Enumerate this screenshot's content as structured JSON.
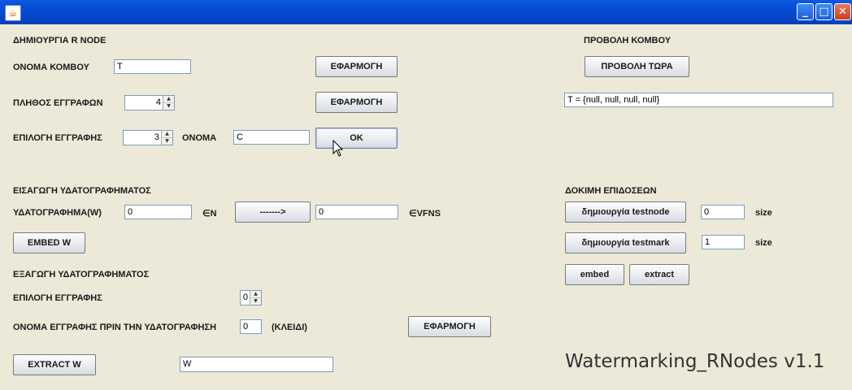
{
  "window": {
    "icon": "java-cup-icon",
    "minimize": "_",
    "maximize": "□",
    "close": "✕"
  },
  "create": {
    "heading": "ΔΗΜΙΟΥΡΓΙΑ R NODE",
    "node_name_label": "ΟΝΟΜΑ ΚΟΜΒΟΥ",
    "node_name_value": "T",
    "apply1": "ΕΦΑΡΜΟΓΗ",
    "records_count_label": "ΠΛΗΘΟΣ ΕΓΓΡΑΦΩΝ",
    "records_count_value": "4",
    "apply2": "ΕΦΑΡΜΟΓΗ",
    "select_record_label": "ΕΠΙΛΟΓΗ ΕΓΓΡΑΦΗΣ",
    "select_record_value": "3",
    "name_label": "ΟΝΟΜΑ",
    "name_value": "C",
    "ok": "OK"
  },
  "view": {
    "heading": "ΠΡΟΒΟΛΗ ΚΟΜΒΟΥ",
    "view_now": "ΠΡΟΒΟΛΗ ΤΩΡΑ",
    "output": "T = {null, null, null, null}"
  },
  "insert": {
    "heading": "ΕΙΣΑΓΩΓΗ ΥΔΑΤΟΓΡΑΦΗΜΑΤΟΣ",
    "watermark_label": "ΥΔΑΤΟΓΡΑΦΗΜΑ(W)",
    "watermark_value": "0",
    "in_n": "∈N",
    "arrow_button": "------->",
    "result_value": "0",
    "in_vfns": "∈VFNS",
    "embed_w": "EMBED W"
  },
  "extract": {
    "heading": "ΕΞΑΓΩΓΗ ΥΔΑΤΟΓΡΑΦΗΜΑΤΟΣ",
    "select_record_label": "ΕΠΙΛΟΓΗ ΕΓΓΡΑΦΗΣ",
    "select_record_value": "0",
    "record_name_label": "ΟΝΟΜΑ ΕΓΓΡΑΦΗΣ ΠΡΙΝ ΤΗΝ ΥΔΑΤΟΓΡΑΦΗΣΗ",
    "record_name_value": "0",
    "key_label": "(ΚΛΕΙΔΙ)",
    "apply": "ΕΦΑΡΜΟΓΗ",
    "extract_w": "EXTRACT W",
    "extract_value": "W"
  },
  "perf": {
    "heading": "ΔΟΚΙΜΗ ΕΠΙΔΟΣΕΩΝ",
    "create_testnode": "δημιουργία testnode",
    "testnode_size": "0",
    "size_label1": "size",
    "create_testmark": "δημιουργία testmark",
    "testmark_size": "1",
    "size_label2": "size",
    "embed": "embed",
    "extract": "extract"
  },
  "app_title": "Watermarking_RNodes v1.1"
}
